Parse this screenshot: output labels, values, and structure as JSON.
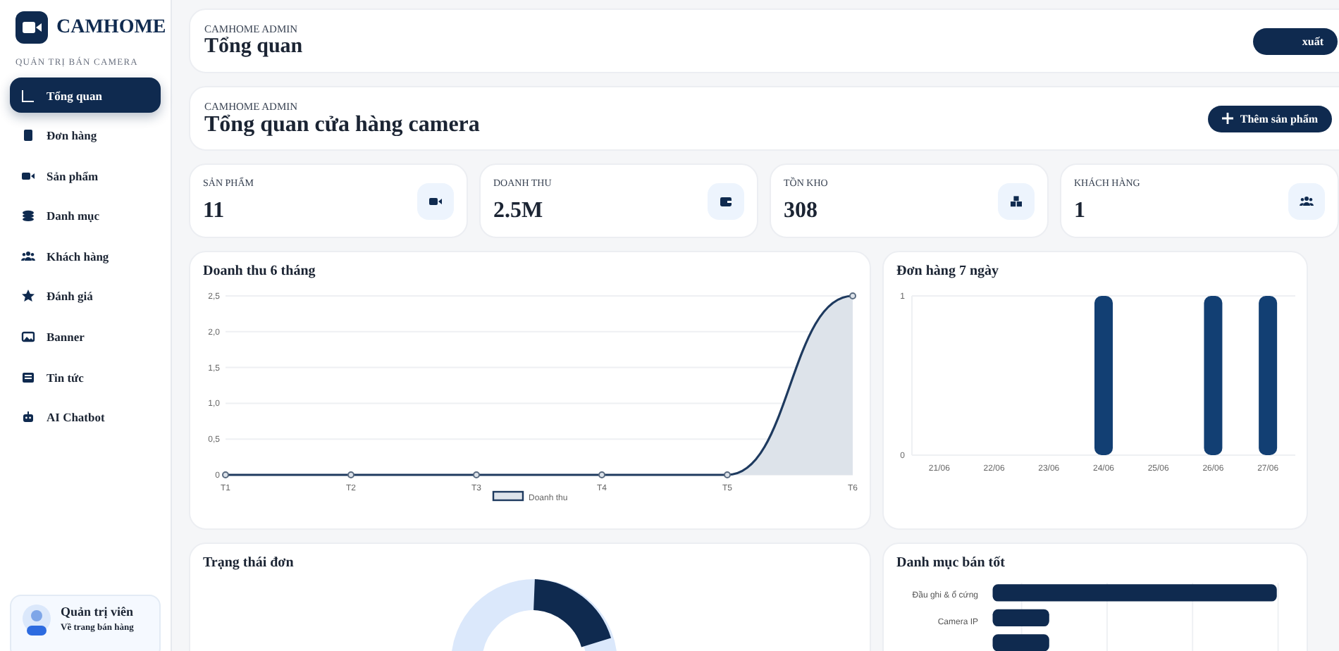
{
  "brand": {
    "name": "CAMHOME",
    "subtitle": "QUẢN TRỊ BÁN CAMERA"
  },
  "nav": [
    {
      "label": "Tổng quan",
      "selected": true
    },
    {
      "label": "Đơn hàng",
      "selected": false
    },
    {
      "label": "Sản phẩm",
      "selected": false
    },
    {
      "label": "Danh mục",
      "selected": false
    },
    {
      "label": "Khách hàng",
      "selected": false
    },
    {
      "label": "Đánh giá",
      "selected": false
    },
    {
      "label": "Banner",
      "selected": false
    },
    {
      "label": "Tin tức",
      "selected": false
    },
    {
      "label": "AI Chatbot",
      "selected": false
    }
  ],
  "user": {
    "name": "Quản trị viên",
    "link": "Về trang bán hàng"
  },
  "topbar": {
    "eyebrow": "CAMHOME ADMIN",
    "title": "Tổng quan",
    "button": "xuất"
  },
  "header": {
    "eyebrow": "CAMHOME ADMIN",
    "title": "Tổng quan cửa hàng camera",
    "button": "Thêm sản phẩm"
  },
  "stats": [
    {
      "label": "SẢN PHẨM",
      "value": "11"
    },
    {
      "label": "DOANH THU",
      "value": "2.5M"
    },
    {
      "label": "TỒN KHO",
      "value": "308"
    },
    {
      "label": "KHÁCH HÀNG",
      "value": "1"
    }
  ],
  "revenue": {
    "title": "Doanh thu 6 tháng",
    "chart_data": {
      "type": "area",
      "categories": [
        "T1",
        "T2",
        "T3",
        "T4",
        "T5",
        "T6"
      ],
      "series": [
        {
          "name": "Doanh thu",
          "color": "#1e3a5f",
          "values": [
            0,
            0,
            0,
            0,
            0,
            2.5
          ]
        }
      ],
      "ylim": [
        0,
        2.5
      ],
      "grid": true,
      "yticks": [
        {
          "value": 0,
          "label": "0"
        },
        {
          "value": 0.5,
          "label": "0,5"
        },
        {
          "value": 1,
          "label": "1,0"
        },
        {
          "value": 1.5,
          "label": "1,5"
        },
        {
          "value": 2,
          "label": "2,0"
        },
        {
          "value": 2.5,
          "label": "2,5"
        }
      ]
    }
  },
  "orders": {
    "title": "Đơn hàng 7 ngày",
    "chart_data": {
      "type": "bar",
      "categories": [
        "21/06",
        "22/06",
        "23/06",
        "24/06",
        "25/06",
        "26/06",
        "27/06"
      ],
      "series": [
        {
          "color": "#123f73",
          "values": [
            0,
            0,
            0,
            1,
            0,
            1,
            1
          ]
        }
      ],
      "ylim": [
        0,
        1
      ],
      "yticks": [
        0,
        1
      ],
      "grid": true
    }
  },
  "status": {
    "title": "Trạng thái đơn"
  },
  "top_categories": {
    "title": "Danh mục bán tốt",
    "labels": [
      "Đầu ghi & ổ cứng",
      "Camera IP"
    ]
  }
}
